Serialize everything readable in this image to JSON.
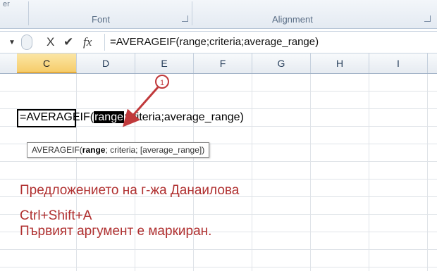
{
  "ribbon": {
    "partial_label": "er",
    "groups": [
      {
        "label": "Font"
      },
      {
        "label": "Alignment"
      }
    ]
  },
  "formula_bar": {
    "name_box_icon": "chevron-down-icon",
    "cancel_glyph": "X",
    "enter_glyph": "✔",
    "fx_label": "fx",
    "formula": "=AVERAGEIF(range;criteria;average_range)"
  },
  "columns": [
    "C",
    "D",
    "E",
    "F",
    "G",
    "H",
    "I"
  ],
  "active_column": "C",
  "cell_editor": {
    "prefix": "=AVERAGEIF(",
    "highlight": "range",
    "suffix": ";criteria;average_range)"
  },
  "tooltip": {
    "func": "AVERAGEIF(",
    "arg_bold": "range",
    "rest": "; criteria; [average_range])"
  },
  "annotation": {
    "number": "1",
    "color": "#c0393b"
  },
  "notes": {
    "line1": "Предложението на г-жа Данаилова",
    "line2": "Ctrl+Shift+A",
    "line3": "Първият аргумент е маркиран."
  },
  "colors": {
    "active_header": "#f6cd6b",
    "note_text": "#b03030"
  }
}
